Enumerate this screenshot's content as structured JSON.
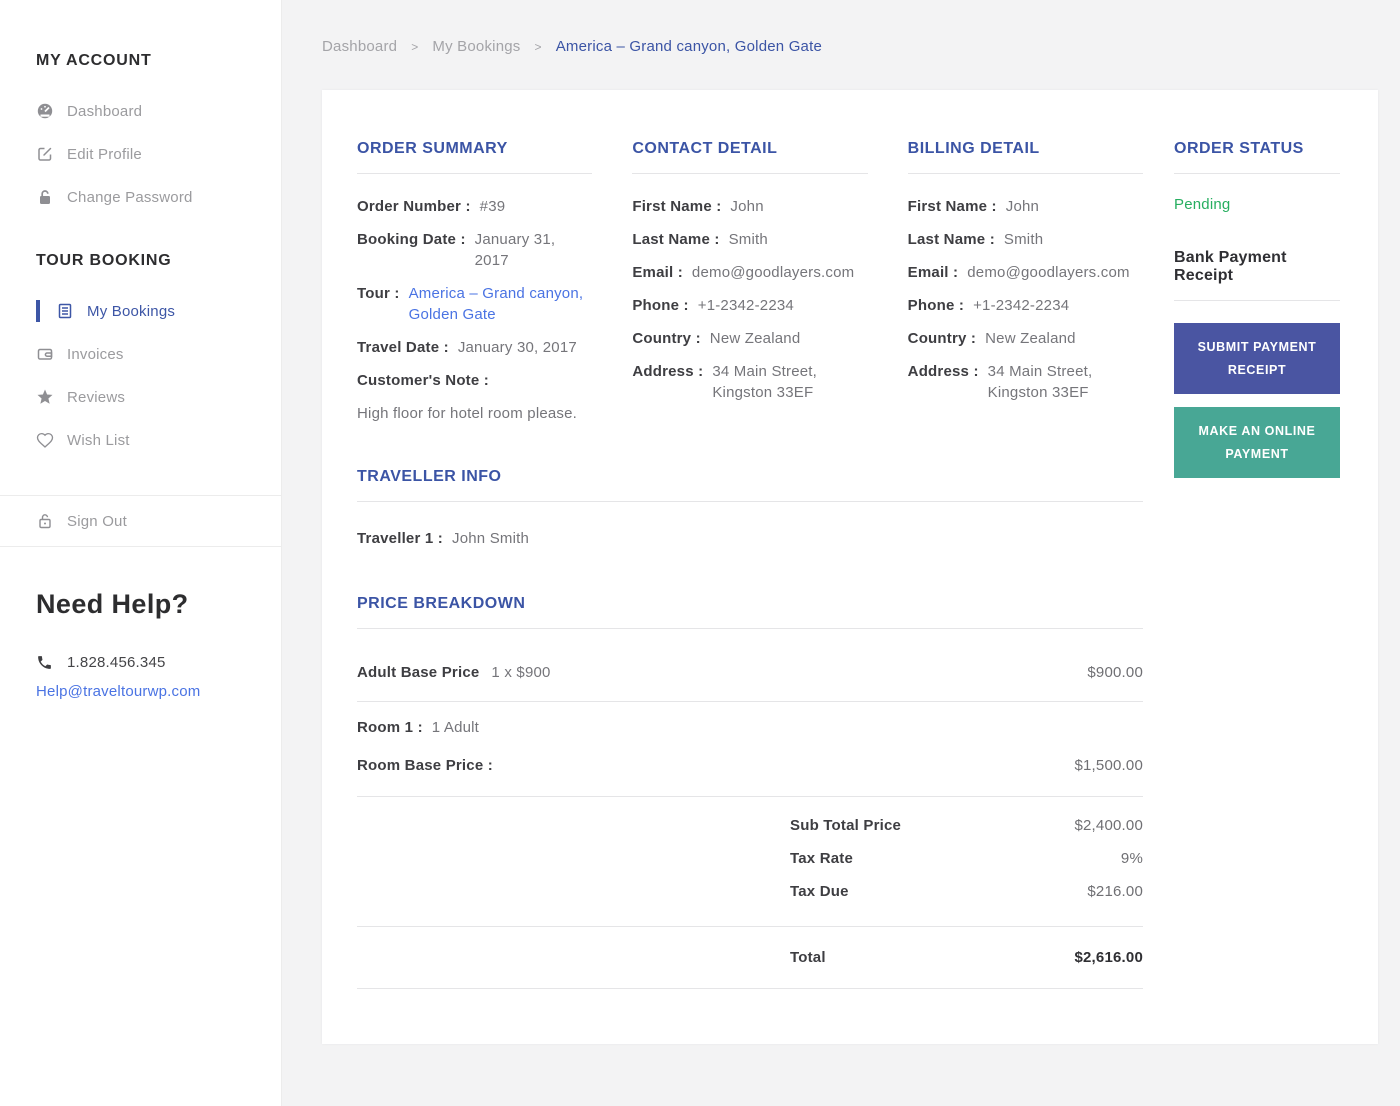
{
  "colors": {
    "accent_indigo": "#3b54a5",
    "link_blue": "#4a73e3",
    "status_green": "#27ae60",
    "button_indigo": "#4a55a2",
    "button_teal": "#48a795"
  },
  "breadcrumb": {
    "home": "Dashboard",
    "section": "My Bookings",
    "current": "America – Grand canyon, Golden Gate"
  },
  "sidebar": {
    "account": {
      "title": "MY ACCOUNT",
      "items": [
        {
          "label": "Dashboard",
          "icon": "dashboard-icon"
        },
        {
          "label": "Edit Profile",
          "icon": "edit-icon"
        },
        {
          "label": "Change Password",
          "icon": "lock-icon"
        }
      ]
    },
    "booking": {
      "title": "TOUR BOOKING",
      "items": [
        {
          "label": "My Bookings",
          "icon": "bookings-icon",
          "active": true
        },
        {
          "label": "Invoices",
          "icon": "wallet-icon"
        },
        {
          "label": "Reviews",
          "icon": "star-icon"
        },
        {
          "label": "Wish List",
          "icon": "heart-icon"
        }
      ]
    },
    "sign_out_label": "Sign Out",
    "help": {
      "title": "Need Help?",
      "phone": "1.828.456.345",
      "email": "Help@traveltourwp.com"
    }
  },
  "order_summary": {
    "title": "ORDER SUMMARY",
    "order_number_label": "Order Number :",
    "order_number": "#39",
    "booking_date_label": "Booking Date :",
    "booking_date": "January 31, 2017",
    "tour_label": "Tour :",
    "tour": "America – Grand canyon, Golden Gate",
    "travel_date_label": "Travel Date :",
    "travel_date": "January 30, 2017",
    "note_label": "Customer's Note :",
    "note": "High floor for hotel room please."
  },
  "contact_detail": {
    "title": "CONTACT DETAIL",
    "fields": [
      {
        "label": "First Name :",
        "value": "John"
      },
      {
        "label": "Last Name :",
        "value": "Smith"
      },
      {
        "label": "Email :",
        "value": "demo@goodlayers.com"
      },
      {
        "label": "Phone :",
        "value": "+1-2342-2234"
      },
      {
        "label": "Country :",
        "value": "New Zealand"
      },
      {
        "label": "Address :",
        "value": "34 Main Street,\nKingston 33EF"
      }
    ]
  },
  "billing_detail": {
    "title": "BILLING DETAIL",
    "fields": [
      {
        "label": "First Name :",
        "value": "John"
      },
      {
        "label": "Last Name :",
        "value": "Smith"
      },
      {
        "label": "Email :",
        "value": "demo@goodlayers.com"
      },
      {
        "label": "Phone :",
        "value": "+1-2342-2234"
      },
      {
        "label": "Country :",
        "value": "New Zealand"
      },
      {
        "label": "Address :",
        "value": "34 Main Street,\nKingston 33EF"
      }
    ]
  },
  "order_status": {
    "title": "ORDER STATUS",
    "status": "Pending",
    "receipt_title": "Bank Payment Receipt",
    "submit_button": "SUBMIT PAYMENT RECEIPT",
    "pay_button": "MAKE AN ONLINE PAYMENT"
  },
  "traveller_info": {
    "title": "TRAVELLER INFO",
    "traveller_label": "Traveller 1 :",
    "traveller_name": "John Smith"
  },
  "price_breakdown": {
    "title": "PRICE BREAKDOWN",
    "adult_label": "Adult Base Price",
    "adult_qty": "1 x $900",
    "adult_amount": "$900.00",
    "room_label": "Room 1 :",
    "room_occupancy": "1 Adult",
    "room_base_label": "Room Base Price :",
    "room_base_amount": "$1,500.00",
    "subtotal_label": "Sub Total Price",
    "subtotal": "$2,400.00",
    "tax_rate_label": "Tax Rate",
    "tax_rate": "9%",
    "tax_due_label": "Tax Due",
    "tax_due": "$216.00",
    "total_label": "Total",
    "total": "$2,616.00"
  }
}
